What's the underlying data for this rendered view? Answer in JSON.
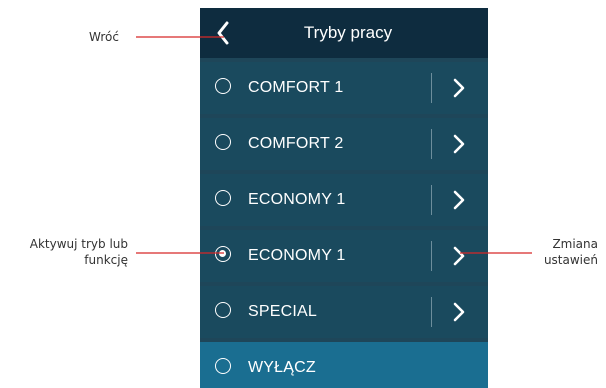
{
  "header": {
    "title": "Tryby pracy",
    "back_icon": "chevron-left-icon"
  },
  "modes": [
    {
      "label": "COMFORT 1",
      "selected": false,
      "has_settings": true
    },
    {
      "label": "COMFORT 2",
      "selected": false,
      "has_settings": true
    },
    {
      "label": "ECONOMY 1",
      "selected": false,
      "has_settings": true
    },
    {
      "label": "ECONOMY 1",
      "selected": true,
      "has_settings": true
    },
    {
      "label": "SPECIAL",
      "selected": false,
      "has_settings": true
    },
    {
      "label": "WYŁĄCZ",
      "selected": false,
      "has_settings": false
    }
  ],
  "annotations": {
    "back": "Wróć",
    "activate_line1": "Aktywuj tryb lub",
    "activate_line2": "funkcję",
    "settings_line1": "Zmiana",
    "settings_line2": "ustawień"
  },
  "colors": {
    "header_bg": "#0e2c3f",
    "row_bg": "#1a4a5e",
    "off_row_bg": "#1a6e91",
    "separator": "#e6e6e6",
    "callout_line": "#d62828"
  }
}
